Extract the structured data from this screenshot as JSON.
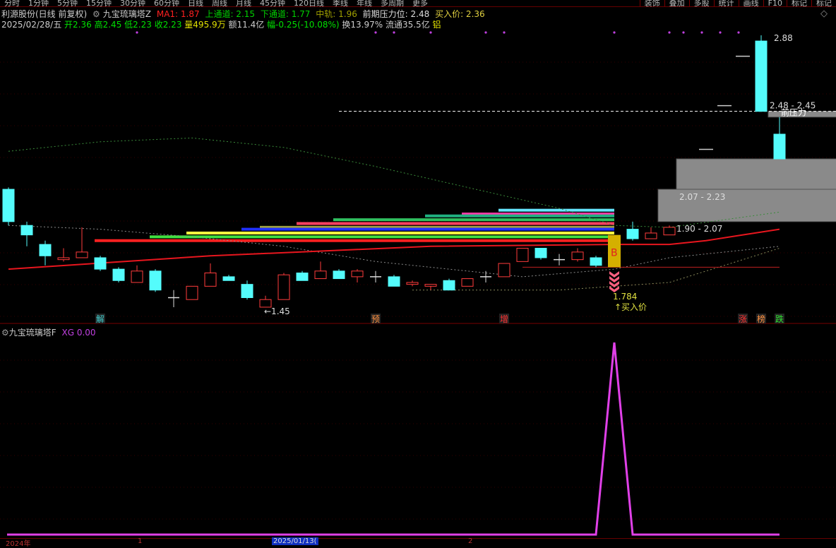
{
  "toolbar": {
    "left": [
      "分时",
      "1分钟",
      "5分钟",
      "15分钟",
      "30分钟",
      "60分钟",
      "日线",
      "周线",
      "月线",
      "45分钟",
      "120日线",
      "季线",
      "年线",
      "多周期",
      "更多"
    ],
    "right": [
      "装饰",
      "叠加",
      "多股",
      "统计",
      "画线",
      "F10",
      "标记",
      "标记"
    ]
  },
  "header": {
    "stock": "利源股份(日线 前复权)",
    "indicator": "九宝琉璃塔Z",
    "ma1": "MA1: 1.87",
    "upper": "上通道: 2.15",
    "lower": "下通道: 1.77",
    "mid": "中轨: 1.96",
    "pressure": "前期压力位: 2.48",
    "buy": "买入价: 2.36",
    "date": "2025/02/28/五",
    "open": "开2.36",
    "high": "高2.45",
    "low": "低2.23",
    "close": "收2.23",
    "vol": "量495.9万",
    "amt": "额11.4亿",
    "chg": "幅-0.25(-10.08%)",
    "turn": "换13.97%",
    "float": "流通35.5亿",
    "tag": "铝"
  },
  "colors": {
    "up": "#ff3c3c",
    "down": "#54fcfc",
    "ma": "#e8161e",
    "xg": "#e040e8",
    "gold": "#d4b000"
  },
  "chart_data": {
    "type": "candlestick",
    "price_range": [
      1.4,
      2.9
    ],
    "candles": [
      {
        "i": 0,
        "o": 2.07,
        "h": 2.08,
        "l": 1.88,
        "c": 1.9
      },
      {
        "i": 1,
        "o": 1.88,
        "h": 1.9,
        "l": 1.77,
        "c": 1.83
      },
      {
        "i": 2,
        "o": 1.78,
        "h": 1.8,
        "l": 1.67,
        "c": 1.72
      },
      {
        "i": 3,
        "o": 1.7,
        "h": 1.76,
        "l": 1.69,
        "c": 1.71
      },
      {
        "i": 4,
        "o": 1.71,
        "h": 1.87,
        "l": 1.71,
        "c": 1.74
      },
      {
        "i": 5,
        "o": 1.71,
        "h": 1.72,
        "l": 1.64,
        "c": 1.65
      },
      {
        "i": 6,
        "o": 1.65,
        "h": 1.66,
        "l": 1.58,
        "c": 1.59
      },
      {
        "i": 7,
        "o": 1.58,
        "h": 1.67,
        "l": 1.58,
        "c": 1.64
      },
      {
        "i": 8,
        "o": 1.64,
        "h": 1.65,
        "l": 1.53,
        "c": 1.54
      },
      {
        "i": 9,
        "o": 1.5,
        "h": 1.54,
        "l": 1.45,
        "c": 1.5
      },
      {
        "i": 10,
        "o": 1.49,
        "h": 1.56,
        "l": 1.49,
        "c": 1.56
      },
      {
        "i": 11,
        "o": 1.56,
        "h": 1.68,
        "l": 1.56,
        "c": 1.63
      },
      {
        "i": 12,
        "o": 1.61,
        "h": 1.62,
        "l": 1.59,
        "c": 1.59
      },
      {
        "i": 13,
        "o": 1.57,
        "h": 1.59,
        "l": 1.49,
        "c": 1.5
      },
      {
        "i": 14,
        "o": 1.45,
        "h": 1.51,
        "l": 1.45,
        "c": 1.49
      },
      {
        "i": 15,
        "o": 1.49,
        "h": 1.63,
        "l": 1.49,
        "c": 1.62
      },
      {
        "i": 16,
        "o": 1.63,
        "h": 1.64,
        "l": 1.59,
        "c": 1.59
      },
      {
        "i": 17,
        "o": 1.6,
        "h": 1.69,
        "l": 1.6,
        "c": 1.64
      },
      {
        "i": 18,
        "o": 1.64,
        "h": 1.65,
        "l": 1.6,
        "c": 1.6
      },
      {
        "i": 19,
        "o": 1.61,
        "h": 1.65,
        "l": 1.58,
        "c": 1.64
      },
      {
        "i": 20,
        "o": 1.61,
        "h": 1.64,
        "l": 1.58,
        "c": 1.61
      },
      {
        "i": 21,
        "o": 1.61,
        "h": 1.62,
        "l": 1.56,
        "c": 1.56
      },
      {
        "i": 22,
        "o": 1.57,
        "h": 1.59,
        "l": 1.56,
        "c": 1.58
      },
      {
        "i": 23,
        "o": 1.56,
        "h": 1.57,
        "l": 1.54,
        "c": 1.57
      },
      {
        "i": 24,
        "o": 1.59,
        "h": 1.6,
        "l": 1.54,
        "c": 1.54
      },
      {
        "i": 25,
        "o": 1.56,
        "h": 1.6,
        "l": 1.56,
        "c": 1.6
      },
      {
        "i": 26,
        "o": 1.61,
        "h": 1.64,
        "l": 1.58,
        "c": 1.61
      },
      {
        "i": 27,
        "o": 1.61,
        "h": 1.68,
        "l": 1.61,
        "c": 1.68
      },
      {
        "i": 28,
        "o": 1.69,
        "h": 1.76,
        "l": 1.69,
        "c": 1.76
      },
      {
        "i": 29,
        "o": 1.76,
        "h": 1.76,
        "l": 1.7,
        "c": 1.71
      },
      {
        "i": 30,
        "o": 1.7,
        "h": 1.73,
        "l": 1.67,
        "c": 1.7
      },
      {
        "i": 31,
        "o": 1.7,
        "h": 1.76,
        "l": 1.69,
        "c": 1.74
      },
      {
        "i": 32,
        "o": 1.71,
        "h": 1.72,
        "l": 1.66,
        "c": 1.67
      },
      {
        "i": 34,
        "o": 1.86,
        "h": 1.9,
        "l": 1.8,
        "c": 1.81
      },
      {
        "i": 35,
        "o": 1.81,
        "h": 1.87,
        "l": 1.81,
        "c": 1.84
      },
      {
        "i": 36,
        "o": 1.83,
        "h": 1.88,
        "l": 1.83,
        "c": 1.87
      },
      {
        "i": 41,
        "o": 2.85,
        "h": 2.88,
        "l": 2.48,
        "c": 2.48
      },
      {
        "i": 42,
        "o": 2.36,
        "h": 2.45,
        "l": 2.23,
        "c": 2.23
      }
    ],
    "buy_signal": {
      "i": 33,
      "top": 1.83,
      "bottom": 1.66,
      "letter": "B",
      "price": "1.784",
      "label": "↑买入价"
    },
    "ma1": [
      [
        0,
        1.65
      ],
      [
        11,
        1.72
      ],
      [
        23,
        1.77
      ],
      [
        33,
        1.78
      ],
      [
        36,
        1.78
      ],
      [
        38,
        1.8
      ],
      [
        40,
        1.83
      ],
      [
        42,
        1.86
      ]
    ],
    "upper_channel": [
      [
        0,
        2.27
      ],
      [
        5,
        2.32
      ],
      [
        10,
        2.34
      ],
      [
        15,
        2.29
      ],
      [
        20,
        2.19
      ],
      [
        25,
        2.08
      ],
      [
        30,
        1.97
      ],
      [
        33,
        1.88
      ],
      [
        36,
        1.87
      ],
      [
        42,
        1.95
      ]
    ],
    "mid_channel": [
      [
        0,
        1.88
      ],
      [
        5,
        1.86
      ],
      [
        10,
        1.82
      ],
      [
        15,
        1.77
      ],
      [
        20,
        1.69
      ],
      [
        25,
        1.64
      ],
      [
        28,
        1.61
      ],
      [
        33,
        1.65
      ],
      [
        36,
        1.71
      ],
      [
        42,
        1.77
      ]
    ],
    "lower_channel": [
      [
        22,
        1.54
      ],
      [
        25,
        1.54
      ],
      [
        30,
        1.54
      ],
      [
        33,
        1.56
      ],
      [
        36,
        1.58
      ],
      [
        42,
        1.76
      ]
    ],
    "support_bars": [
      {
        "p": 1.96,
        "from": 27,
        "color": "#66e6ff"
      },
      {
        "p": 1.94,
        "from": 25,
        "color": "#ff3aa8"
      },
      {
        "p": 1.93,
        "from": 23,
        "color": "#20b080"
      },
      {
        "p": 1.91,
        "from": 18,
        "color": "#30c060"
      },
      {
        "p": 1.89,
        "from": 16,
        "color": "#ff4060"
      },
      {
        "p": 1.87,
        "from": 14,
        "color": "#a0a040"
      },
      {
        "p": 1.86,
        "from": 13,
        "color": "#2030ff"
      },
      {
        "p": 1.84,
        "from": 10,
        "color": "#ffff40"
      },
      {
        "p": 1.82,
        "from": 8,
        "color": "#40e040"
      },
      {
        "p": 1.8,
        "from": 5,
        "color": "#ff2020"
      }
    ],
    "zones": [
      {
        "lo": 2.07,
        "hi": 2.23,
        "from": 37,
        "label": "2.07 - 2.23"
      },
      {
        "lo": 1.9,
        "hi": 2.07,
        "from": 36,
        "label": "1.90 - 2.07"
      },
      {
        "lo": 2.45,
        "hi": 2.48,
        "from": 42,
        "label": "2.48 - 2.45",
        "tag": "前压力"
      }
    ],
    "pressure_line": 2.48,
    "buy_line": 1.66,
    "high_label": "2.88",
    "low_label": "←1.45",
    "dashes": [
      [
        38,
        2.28
      ],
      [
        39,
        2.51
      ],
      [
        40,
        2.77
      ]
    ],
    "dots": [
      7,
      20,
      21,
      23,
      26,
      27,
      33,
      36,
      37,
      38,
      39,
      40
    ],
    "signals": [
      {
        "i": 5,
        "text": "解",
        "color": "#40d0d0"
      },
      {
        "i": 20,
        "text": "预",
        "color": "#ff9040"
      },
      {
        "i": 27,
        "text": "增",
        "color": "#ff3030"
      },
      {
        "i": 40,
        "text": "涨",
        "color": "#ff3030"
      },
      {
        "i": 41,
        "text": "榜",
        "color": "#ff9040"
      },
      {
        "i": 42,
        "text": "跌",
        "color": "#30e030"
      }
    ]
  },
  "sub": {
    "title": "九宝琉璃塔F",
    "xg": "XG  0.00",
    "series": {
      "name": "XG",
      "spike_at": 33,
      "range": [
        0,
        1
      ]
    }
  },
  "xaxis": [
    "2024年",
    "1",
    "2025/01/13(",
    "2"
  ]
}
